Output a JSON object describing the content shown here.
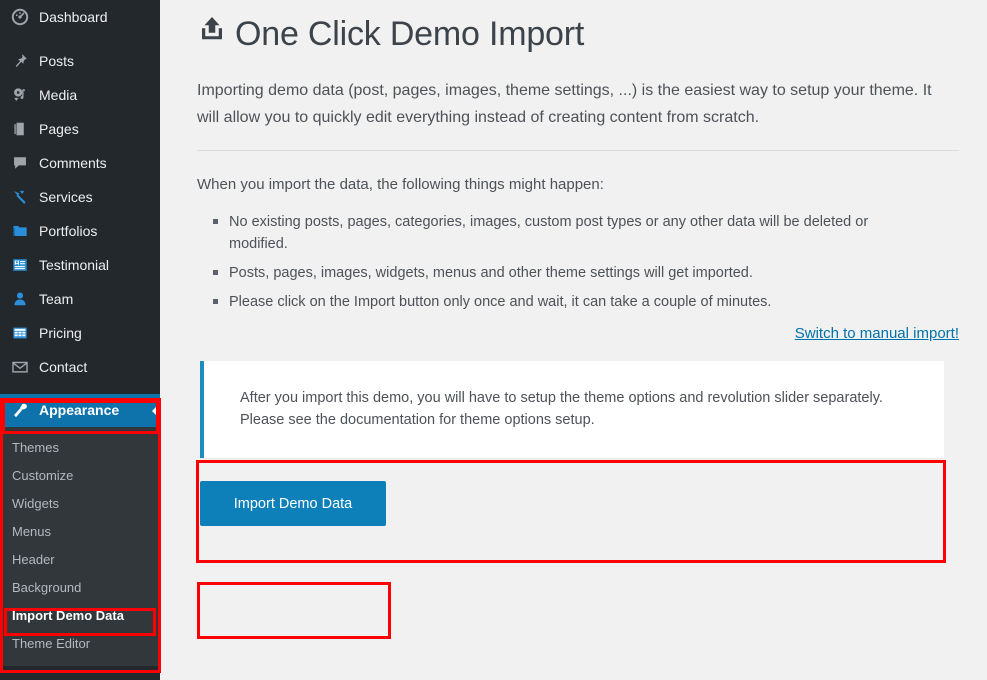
{
  "sidebar": {
    "items": [
      {
        "label": "Dashboard",
        "icon": "dashboard-icon",
        "icon_color": "#a0a5aa"
      },
      {
        "label": "Posts",
        "icon": "pin-icon",
        "icon_color": "#a0a5aa"
      },
      {
        "label": "Media",
        "icon": "media-icon",
        "icon_color": "#a0a5aa"
      },
      {
        "label": "Pages",
        "icon": "pages-icon",
        "icon_color": "#a0a5aa"
      },
      {
        "label": "Comments",
        "icon": "comments-icon",
        "icon_color": "#a0a5aa"
      },
      {
        "label": "Services",
        "icon": "hammer-icon",
        "icon_color": "#2a8fd8"
      },
      {
        "label": "Portfolios",
        "icon": "portfolio-icon",
        "icon_color": "#2a8fd8"
      },
      {
        "label": "Testimonial",
        "icon": "testimonial-icon",
        "icon_color": "#2a8fd8"
      },
      {
        "label": "Team",
        "icon": "user-icon",
        "icon_color": "#2a8fd8"
      },
      {
        "label": "Pricing",
        "icon": "pricing-icon",
        "icon_color": "#2a8fd8"
      },
      {
        "label": "Contact",
        "icon": "envelope-icon",
        "icon_color": "#a0a5aa"
      }
    ],
    "current_item": {
      "label": "Appearance",
      "icon": "appearance-brush-icon"
    },
    "submenu": [
      {
        "label": "Themes",
        "current": false
      },
      {
        "label": "Customize",
        "current": false
      },
      {
        "label": "Widgets",
        "current": false
      },
      {
        "label": "Menus",
        "current": false
      },
      {
        "label": "Header",
        "current": false
      },
      {
        "label": "Background",
        "current": false
      },
      {
        "label": "Import Demo Data",
        "current": true
      },
      {
        "label": "Theme Editor",
        "current": false
      }
    ],
    "colors": {
      "background": "#23282d",
      "submenu_background": "#32373c",
      "current_highlight": "#0f73ab"
    }
  },
  "main": {
    "title": "One Click Demo Import",
    "title_icon": "upload-icon",
    "intro": "Importing demo data (post, pages, images, theme settings, ...) is the easiest way to setup your theme. It will allow you to quickly edit everything instead of creating content from scratch.",
    "lead": "When you import the data, the following things might happen:",
    "bullets": [
      "No existing posts, pages, categories, images, custom post types or any other data will be deleted or modified.",
      "Posts, pages, images, widgets, menus and other theme settings will get imported.",
      "Please click on the Import button only once and wait, it can take a couple of minutes."
    ],
    "manual_link": "Switch to manual import!",
    "notice": "After you import this demo, you will have to setup the theme options and revolution slider separately. Please see the documentation for theme options setup.",
    "import_button": "Import Demo Data"
  },
  "annotations": {
    "color": "#ff0000",
    "boxes": [
      "appearance-menu-block",
      "appearance-menu-row",
      "import-demo-data-menu-item",
      "notice-box",
      "import-demo-data-button"
    ]
  },
  "colors": {
    "content_background": "#f1f1f1",
    "primary_button": "#0e80b9",
    "link": "#0073aa",
    "notice_accent": "#1e8cbe",
    "title_text": "#3c434a"
  }
}
